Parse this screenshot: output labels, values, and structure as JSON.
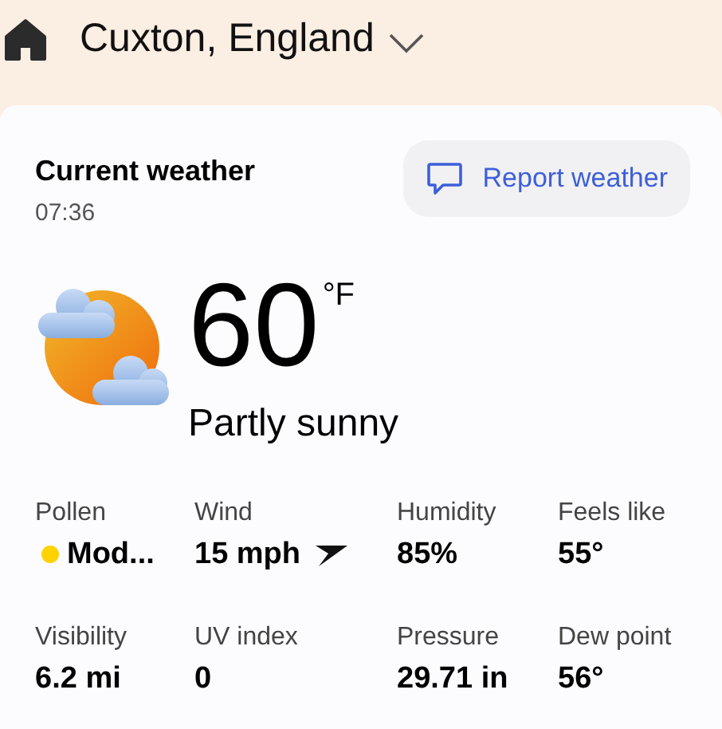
{
  "header": {
    "location": "Cuxton, England"
  },
  "card": {
    "title": "Current weather",
    "time": "07:36",
    "report_button": "Report weather",
    "temperature": "60",
    "unit": "°F",
    "condition": "Partly sunny",
    "details": [
      {
        "kind": "dot",
        "label": "Pollen",
        "value": "Mod...",
        "color": "#ffd200"
      },
      {
        "kind": "wind",
        "label": "Wind",
        "value": "15 mph"
      },
      {
        "kind": "plain",
        "label": "Humidity",
        "value": "85%"
      },
      {
        "kind": "plain",
        "label": "Feels like",
        "value": "55°"
      },
      {
        "kind": "plain",
        "label": "Visibility",
        "value": "6.2 mi"
      },
      {
        "kind": "plain",
        "label": "UV index",
        "value": "0"
      },
      {
        "kind": "plain",
        "label": "Pressure",
        "value": "29.71 in"
      },
      {
        "kind": "plain",
        "label": "Dew point",
        "value": "56°"
      }
    ]
  }
}
